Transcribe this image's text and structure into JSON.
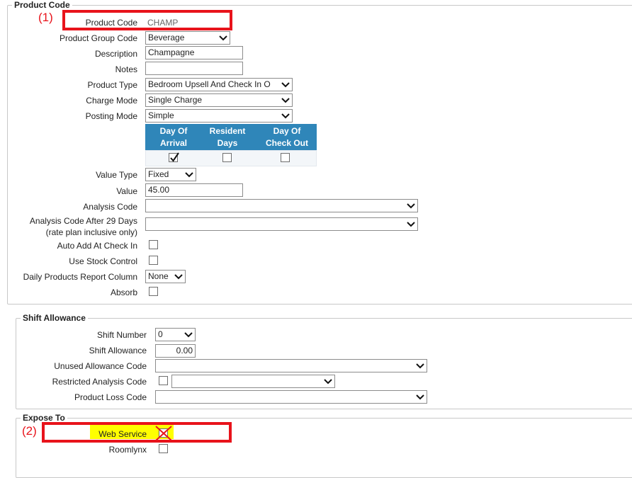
{
  "product_code_section": {
    "legend": "Product Code",
    "fields": {
      "product_code": {
        "label": "Product Code",
        "value": "CHAMP"
      },
      "product_group_code": {
        "label": "Product Group Code",
        "value": "Beverage"
      },
      "description": {
        "label": "Description",
        "value": "Champagne"
      },
      "notes": {
        "label": "Notes",
        "value": ""
      },
      "product_type": {
        "label": "Product Type",
        "value": "Bedroom Upsell And Check In O"
      },
      "charge_mode": {
        "label": "Charge Mode",
        "value": "Single Charge"
      },
      "posting_mode": {
        "label": "Posting Mode",
        "value": "Simple"
      },
      "value_type": {
        "label": "Value Type",
        "value": "Fixed"
      },
      "value": {
        "label": "Value",
        "value": "45.00"
      },
      "analysis_code": {
        "label": "Analysis Code",
        "value": ""
      },
      "analysis_code_after": {
        "label_line1": "Analysis Code After 29 Days",
        "label_line2": "(rate plan inclusive only)",
        "value": ""
      },
      "auto_add": {
        "label": "Auto Add At Check In",
        "checked": false
      },
      "use_stock": {
        "label": "Use Stock Control",
        "checked": false
      },
      "daily_products": {
        "label": "Daily Products Report Column",
        "value": "None"
      },
      "absorb": {
        "label": "Absorb",
        "checked": false
      }
    },
    "posting_days": {
      "columns": [
        {
          "line1": "Day Of",
          "line2": "Arrival",
          "checked": true
        },
        {
          "line1": "Resident",
          "line2": "Days",
          "checked": false
        },
        {
          "line1": "Day Of",
          "line2": "Check Out",
          "checked": false
        }
      ]
    }
  },
  "shift_allowance_section": {
    "legend": "Shift Allowance",
    "shift_number": {
      "label": "Shift Number",
      "value": "0"
    },
    "shift_allowance": {
      "label": "Shift Allowance",
      "value": "0.00"
    },
    "unused_allowance_code": {
      "label": "Unused Allowance Code",
      "value": ""
    },
    "restricted_analysis_code": {
      "label": "Restricted Analysis Code",
      "checked": false,
      "value": ""
    },
    "product_loss_code": {
      "label": "Product Loss Code",
      "value": ""
    }
  },
  "expose_to_section": {
    "legend": "Expose To",
    "web_service": {
      "label": "Web Service",
      "checked": false
    },
    "roomlynx": {
      "label": "Roomlynx",
      "checked": false
    }
  },
  "annotations": {
    "note1": "(1)",
    "note2": "(2)"
  },
  "colors": {
    "accent_header": "#2f86b9",
    "annotation_red": "#e8131b",
    "highlight_yellow": "#ffff00"
  }
}
